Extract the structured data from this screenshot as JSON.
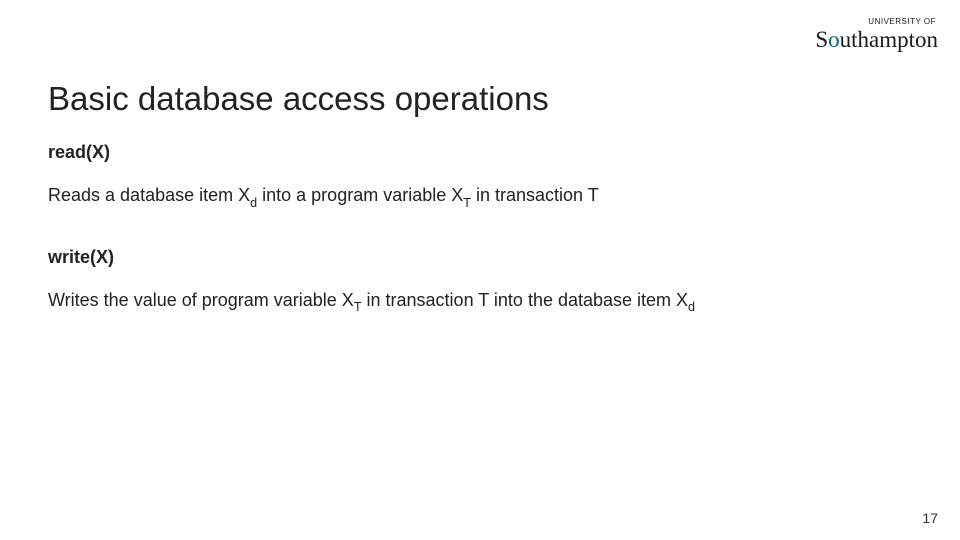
{
  "logo": {
    "small": "UNIVERSITY OF",
    "main_pre": "S",
    "main_accent": "o",
    "main_post": "uthampton"
  },
  "title": "Basic database access operations",
  "read": {
    "name": "read(X)",
    "desc_pre": "Reads a database item X",
    "desc_sub1": "d",
    "desc_mid": " into a program variable X",
    "desc_sub2": "T",
    "desc_post": " in transaction T"
  },
  "write": {
    "name": "write(X)",
    "desc_pre": "Writes the value of program variable X",
    "desc_sub1": "T",
    "desc_mid": " in transaction T into the database item X",
    "desc_sub2": "d",
    "desc_post": ""
  },
  "page_number": "17"
}
